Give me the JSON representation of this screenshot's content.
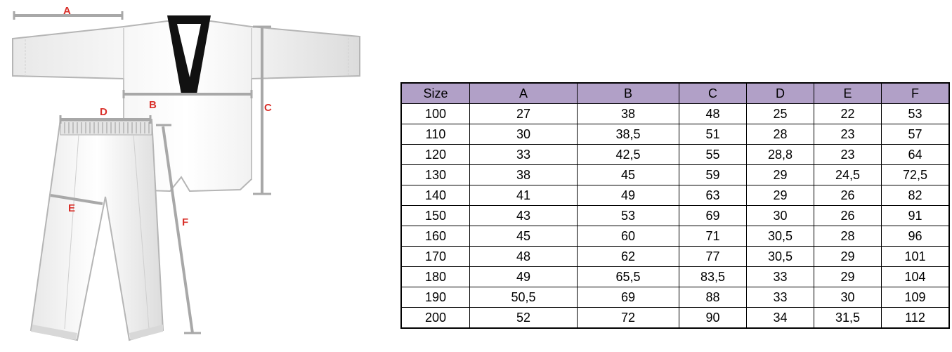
{
  "illustration": {
    "labels": {
      "a": "A",
      "b": "B",
      "c": "C",
      "d": "D",
      "e": "E",
      "f": "F"
    }
  },
  "table": {
    "header_color": "#b1a0c7",
    "columns": [
      "Size",
      "A",
      "B",
      "C",
      "D",
      "E",
      "F"
    ],
    "rows": [
      [
        "100",
        "27",
        "38",
        "48",
        "25",
        "22",
        "53"
      ],
      [
        "110",
        "30",
        "38,5",
        "51",
        "28",
        "23",
        "57"
      ],
      [
        "120",
        "33",
        "42,5",
        "55",
        "28,8",
        "23",
        "64"
      ],
      [
        "130",
        "38",
        "45",
        "59",
        "29",
        "24,5",
        "72,5"
      ],
      [
        "140",
        "41",
        "49",
        "63",
        "29",
        "26",
        "82"
      ],
      [
        "150",
        "43",
        "53",
        "69",
        "30",
        "26",
        "91"
      ],
      [
        "160",
        "45",
        "60",
        "71",
        "30,5",
        "28",
        "96"
      ],
      [
        "170",
        "48",
        "62",
        "77",
        "30,5",
        "29",
        "101"
      ],
      [
        "180",
        "49",
        "65,5",
        "83,5",
        "33",
        "29",
        "104"
      ],
      [
        "190",
        "50,5",
        "69",
        "88",
        "33",
        "30",
        "109"
      ],
      [
        "200",
        "52",
        "72",
        "90",
        "34",
        "31,5",
        "112"
      ]
    ]
  }
}
